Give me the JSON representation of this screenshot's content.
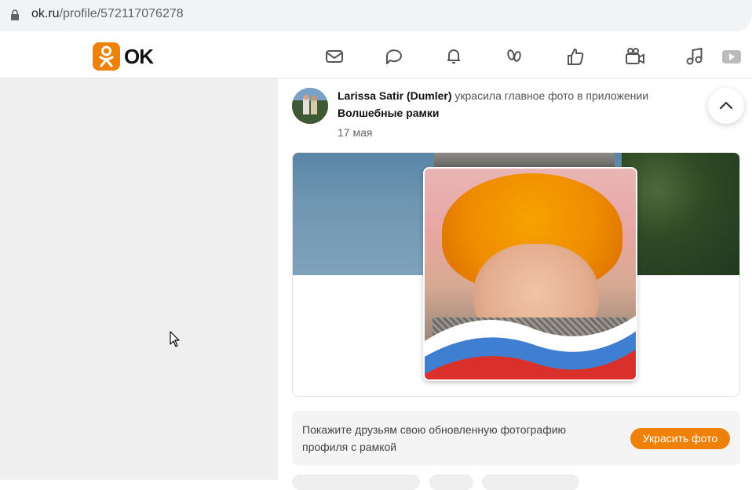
{
  "browser": {
    "url_host": "ok.ru",
    "url_path": "/profile/572117076278"
  },
  "header": {
    "logo_text": "OK",
    "brand_color": "#ee8208",
    "nav_icons": [
      "messages-icon",
      "discussions-icon",
      "notifications-icon",
      "guests-icon",
      "events-icon",
      "video-icon",
      "music-icon",
      "video-tab-icon"
    ]
  },
  "post": {
    "author": "Larissa Satir (Dumler)",
    "action": "украсила главное фото в приложении",
    "app_name": "Волшебные рамки",
    "date": "17 мая"
  },
  "promo": {
    "text": "Покажите друзьям свою обновленную фотографию профиля с рамкой",
    "button_label": "Украсить фото"
  }
}
